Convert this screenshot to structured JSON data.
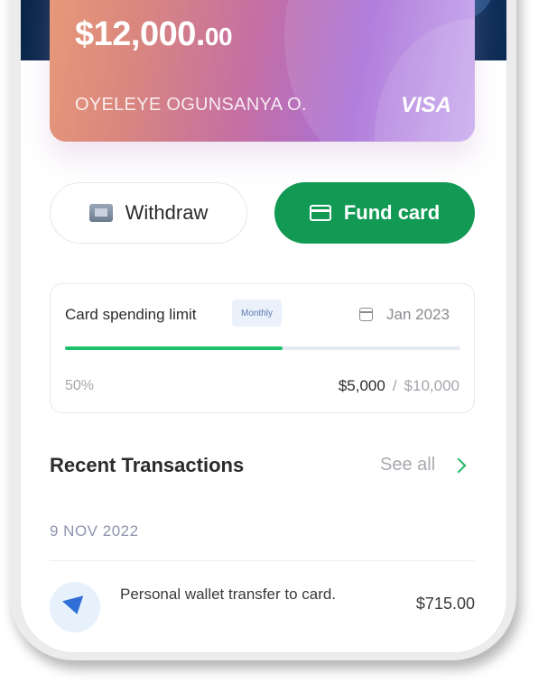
{
  "card": {
    "balance_main": "$12,000.",
    "balance_cents": "00",
    "holder_name": "OYELEYE OGUNSANYA O.",
    "brand": "VISA"
  },
  "actions": {
    "withdraw_label": "Withdraw",
    "fund_label": "Fund card"
  },
  "spending_limit": {
    "title": "Card spending limit",
    "period_badge": "Monthly",
    "date": "Jan 2023",
    "progress_percent": 55,
    "percent_label": "50%",
    "spent": "$5,000",
    "separator": "/",
    "limit": "$10,000"
  },
  "transactions": {
    "title": "Recent Transactions",
    "see_all_label": "See all",
    "date_group": "9 NOV 2022",
    "items": [
      {
        "icon": "send-icon",
        "description": "Personal wallet transfer to card.",
        "amount": "$715.00"
      }
    ]
  },
  "colors": {
    "accent_green": "#129a54",
    "progress_green": "#1cc06a",
    "header_navy": "#0c2b52"
  }
}
